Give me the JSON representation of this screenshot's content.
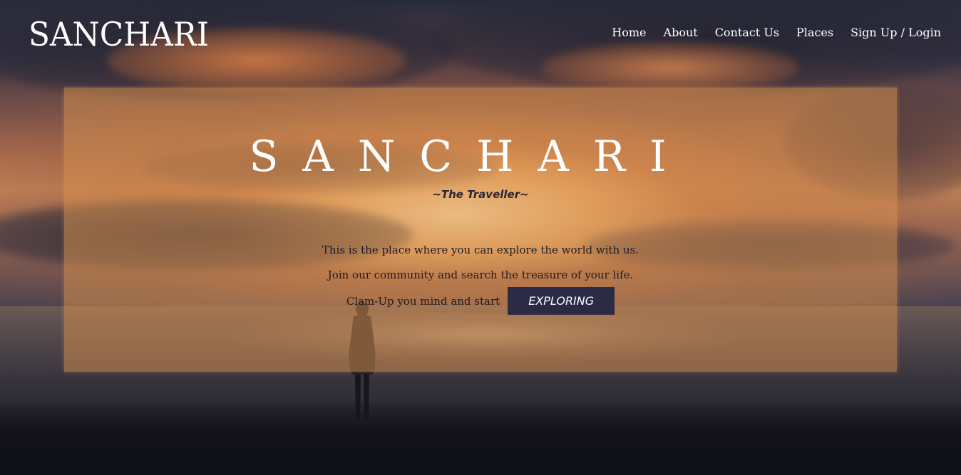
{
  "header": {
    "logo": "SANCHARI",
    "nav": [
      "Home",
      "About",
      "Contact Us",
      "Places",
      "Sign Up / Login"
    ]
  },
  "hero": {
    "title": "SANCHARI",
    "subtitle": "~The Traveller~",
    "line1": "This is the place where you can explore the world with us.",
    "line2": "Join our community and search the treasure of your life.",
    "line3": "Clam-Up you mind and start",
    "button_label": "EXPLORING"
  },
  "colors": {
    "hero_overlay": "#d8924e",
    "button_bg": "#2c2b46",
    "text_light": "#ffffff",
    "text_dark": "#1e1a22"
  }
}
